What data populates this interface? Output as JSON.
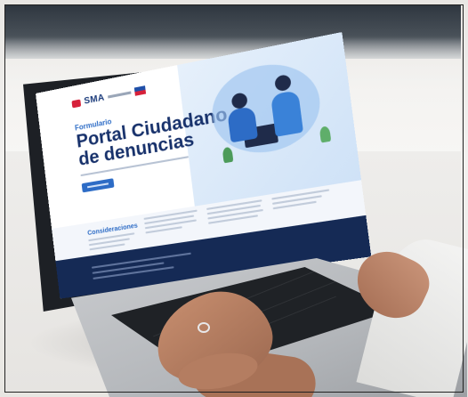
{
  "screen": {
    "logo_text": "SMA",
    "kicker": "Formulario",
    "title_line1": "Portal Ciudadano",
    "title_line2": "de denuncias",
    "considerations_title": "Consideraciones"
  },
  "colors": {
    "brand_blue": "#17316b",
    "accent_blue": "#2d6cc6",
    "footer_navy": "#152a55",
    "flag_red": "#d6213a"
  },
  "icons": {
    "social": [
      "facebook-icon",
      "twitter-icon",
      "linkedin-icon",
      "youtube-icon"
    ]
  }
}
